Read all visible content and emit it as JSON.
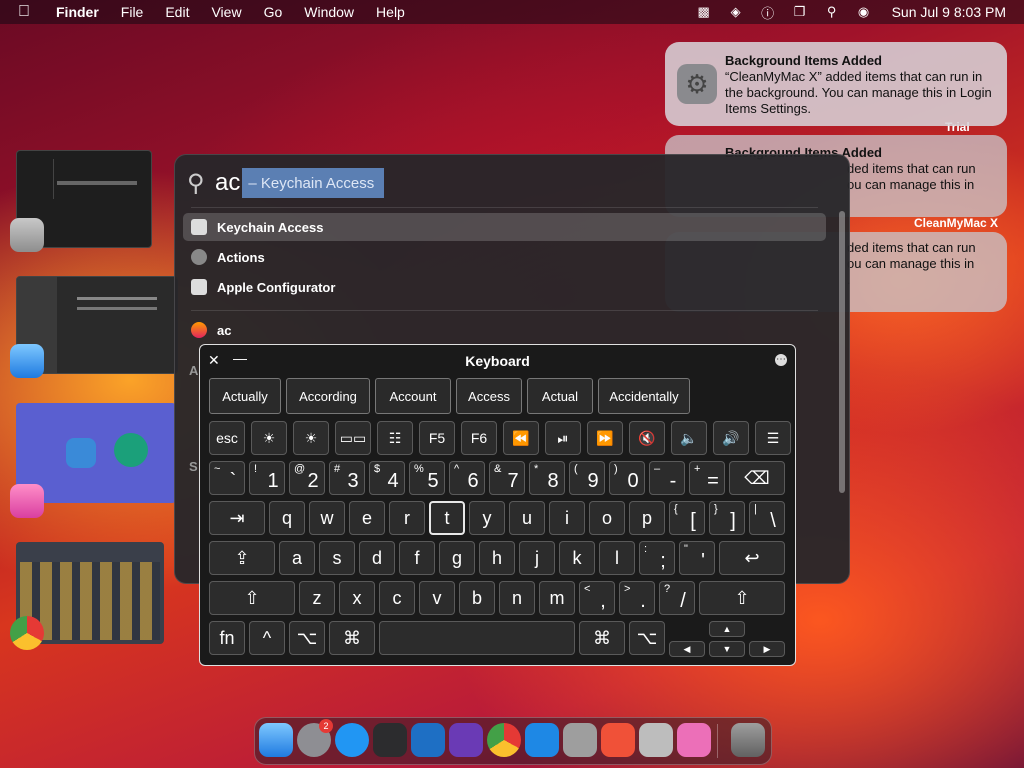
{
  "menubar": {
    "app": "Finder",
    "items": [
      "File",
      "Edit",
      "View",
      "Go",
      "Window",
      "Help"
    ],
    "clock": "Sun Jul 9  8:03 PM"
  },
  "notifications": [
    {
      "title": "Background Items Added",
      "body": "“CleanMyMac X” added items that can run in the background. You can manage this in Login Items Settings."
    },
    {
      "title": "Background Items Added",
      "body": "ded items that can run\nou can manage this in"
    },
    {
      "title": "",
      "body": "ded items that can run\nou can manage this in\n."
    }
  ],
  "notif_side": {
    "trial": "Trial",
    "cleanmymac": "CleanMyMac X"
  },
  "spotlight": {
    "query": "ac",
    "completion": "– Keychain Access",
    "results": [
      "Keychain Access",
      "Actions",
      "Apple Configurator"
    ],
    "web_suggestion": "ac",
    "section_letters": [
      "A",
      "S"
    ]
  },
  "keyboard": {
    "title": "Keyboard",
    "suggestions": [
      "Actually",
      "According",
      "Account",
      "Access",
      "Actual",
      "Accidentally"
    ],
    "fn_row": [
      "esc",
      "☀",
      "☀",
      "▭▭",
      "☷",
      "F5",
      "F6",
      "⏪",
      "⏯",
      "⏩",
      "🔇",
      "🔈",
      "🔊",
      "☰"
    ],
    "num_row": [
      [
        "~",
        "`"
      ],
      [
        "!",
        "1"
      ],
      [
        "@",
        "2"
      ],
      [
        "#",
        "3"
      ],
      [
        "$",
        "4"
      ],
      [
        "%",
        "5"
      ],
      [
        "^",
        "6"
      ],
      [
        "&",
        "7"
      ],
      [
        "*",
        "8"
      ],
      [
        "(",
        "9"
      ],
      [
        ")",
        "0"
      ],
      [
        "–",
        "-"
      ],
      [
        "+",
        "="
      ]
    ],
    "backspace": "⌫",
    "tab": "⇥",
    "row_q": [
      "q",
      "w",
      "e",
      "r",
      "t",
      "y",
      "u",
      "i",
      "o",
      "p"
    ],
    "row_q_brackets": [
      [
        "{",
        "["
      ],
      [
        "}",
        "]"
      ],
      [
        "|",
        "\\"
      ]
    ],
    "caps": "⇪",
    "row_a": [
      "a",
      "s",
      "d",
      "f",
      "g",
      "h",
      "j",
      "k",
      "l"
    ],
    "row_a_punct": [
      [
        ":",
        ";"
      ],
      [
        "\"",
        "'"
      ]
    ],
    "return": "↩",
    "shift": "⇧",
    "row_z": [
      "z",
      "x",
      "c",
      "v",
      "b",
      "n",
      "m"
    ],
    "row_z_punct": [
      [
        "<",
        ","
      ],
      [
        ">",
        "."
      ],
      [
        "?",
        "/"
      ]
    ],
    "bottom": {
      "fn": "fn",
      "ctrl": "^",
      "opt": "⌥",
      "cmd": "⌘",
      "up": "▲",
      "left": "◀",
      "down": "▼",
      "right": "▶"
    },
    "highlighted_key": "t"
  },
  "dock": {
    "badge": "2"
  }
}
